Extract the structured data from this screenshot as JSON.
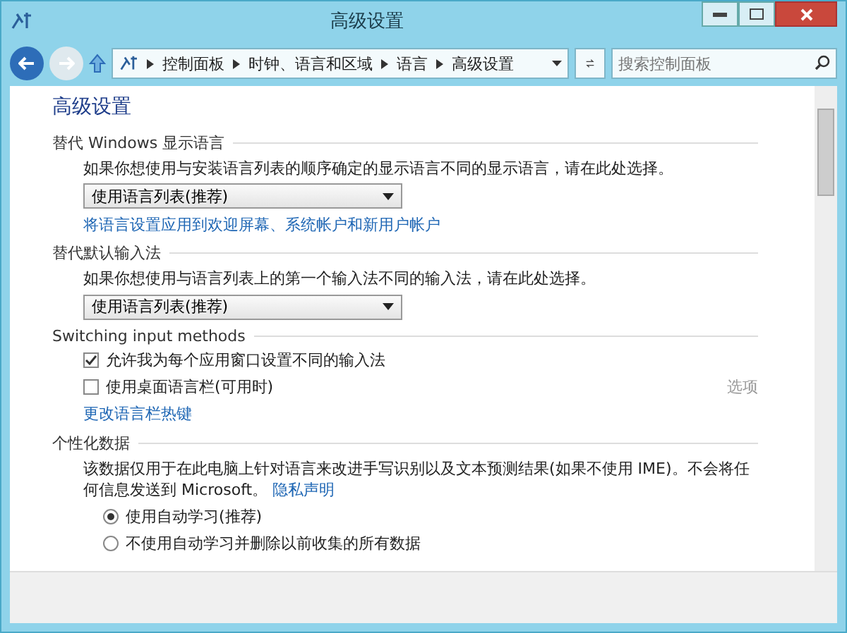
{
  "window": {
    "title": "高级设置"
  },
  "nav": {
    "breadcrumb": [
      "控制面板",
      "时钟、语言和区域",
      "语言",
      "高级设置"
    ],
    "search": {
      "placeholder": "搜索控制面板"
    }
  },
  "page": {
    "heading": "高级设置",
    "sections": [
      {
        "title": "替代 Windows 显示语言",
        "items": [
          {
            "kind": "text",
            "text": "如果你想使用与安装语言列表的顺序确定的显示语言不同的显示语言，请在此处选择。"
          },
          {
            "kind": "dropdown",
            "value": "使用语言列表(推荐)"
          },
          {
            "kind": "link",
            "text": "将语言设置应用到欢迎屏幕、系统帐户和新用户帐户"
          }
        ]
      },
      {
        "title": "替代默认输入法",
        "items": [
          {
            "kind": "text",
            "text": "如果你想使用与语言列表上的第一个输入法不同的输入法，请在此处选择。"
          },
          {
            "kind": "dropdown",
            "value": "使用语言列表(推荐)"
          }
        ]
      },
      {
        "title": "Switching input methods",
        "items": [
          {
            "kind": "checkbox",
            "text": "允许我为每个应用窗口设置不同的输入法",
            "checked": true
          },
          {
            "kind": "checkbox",
            "text": "使用桌面语言栏(可用时)",
            "checked": false,
            "option": {
              "text": "选项",
              "disabled": true
            }
          },
          {
            "kind": "link",
            "text": "更改语言栏热键"
          }
        ]
      },
      {
        "title": "个性化数据",
        "items": [
          {
            "kind": "text",
            "text": "该数据仅用于在此电脑上针对语言来改进手写识别以及文本预测结果(如果不使用 IME)。不会将任何信息发送到 Microsoft。",
            "link": "隐私声明"
          },
          {
            "kind": "radio",
            "text": "使用自动学习(推荐)",
            "selected": true
          },
          {
            "kind": "radio",
            "text": "不使用自动学习并删除以前收集的所有数据",
            "selected": false
          }
        ]
      }
    ]
  }
}
